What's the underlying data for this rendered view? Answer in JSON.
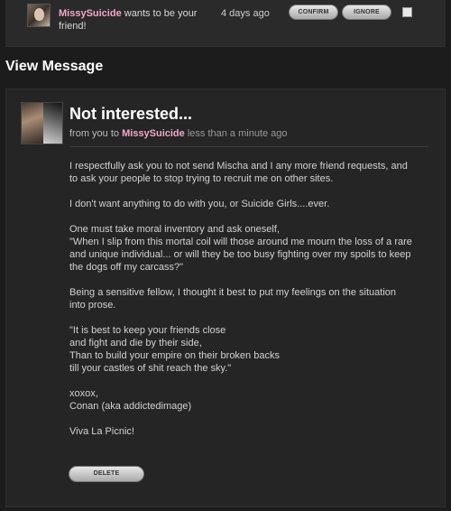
{
  "friend_request": {
    "name": "MissySuicide",
    "text_line1": " wants to be your",
    "text_line2": "friend!",
    "time": "4 days ago",
    "confirm_label": "CONFIRM",
    "ignore_label": "IGNORE"
  },
  "page": {
    "section_title": "View Message"
  },
  "message": {
    "subject": "Not interested...",
    "meta_prefix": "from you to ",
    "recipient": "MissySuicide",
    "time": " less than a minute ago",
    "paragraphs": [
      [
        "I respectfully ask you to not send Mischa and I any more friend requests, and",
        "to ask your people to stop trying to recruit me on other sites."
      ],
      [
        "I don't want anything to do with you, or Suicide Girls....ever."
      ],
      [
        "One must take moral inventory and ask oneself,",
        "\"When I slip from this mortal coil will those around me mourn the loss of a rare",
        "and unique individual... or will they be too busy fighting over my spoils to keep",
        "the dogs off my carcass?\""
      ],
      [
        "Being a sensitive fellow, I thought it best to put my feelings on the situation",
        "into prose."
      ],
      [
        "\"It is best to keep your friends close",
        "and fight and die by their side,",
        "Than to build your empire on their broken backs",
        "till your castles of shit reach the sky.\""
      ],
      [
        "xoxox,",
        "Conan (aka addictedimage)"
      ],
      [
        "Viva La Picnic!"
      ]
    ],
    "delete_label": "DELETE"
  }
}
